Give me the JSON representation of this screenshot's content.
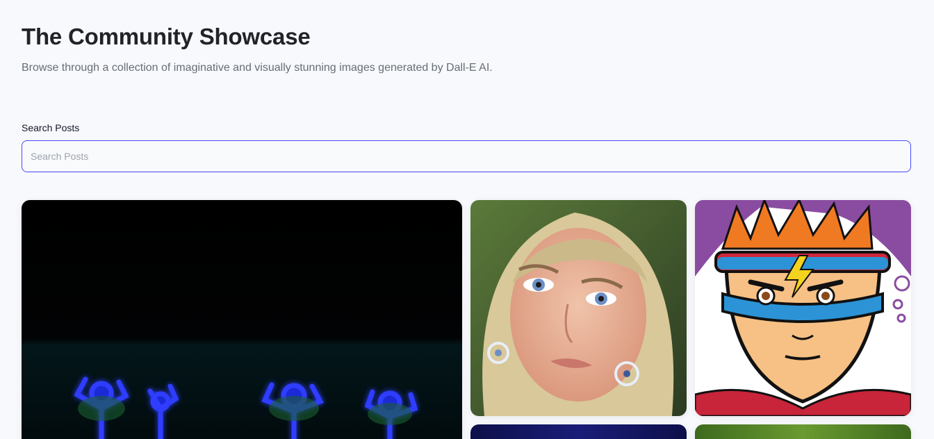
{
  "header": {
    "title": "The Community Showcase",
    "subtitle": "Browse through a collection of imaginative and visually stunning images generated by Dall-E AI."
  },
  "search": {
    "label": "Search Posts",
    "placeholder": "Search Posts",
    "value": ""
  },
  "gallery": {
    "cards": [
      {
        "name": "neon-figures-image"
      },
      {
        "name": "woman-portrait-image"
      },
      {
        "name": "superhero-cartoon-image"
      },
      {
        "name": "blue-image"
      },
      {
        "name": "green-image"
      }
    ]
  },
  "colors": {
    "background": "#f8f9fd",
    "accent": "#4649ff",
    "title": "#222328",
    "subtitle": "#666e75"
  }
}
